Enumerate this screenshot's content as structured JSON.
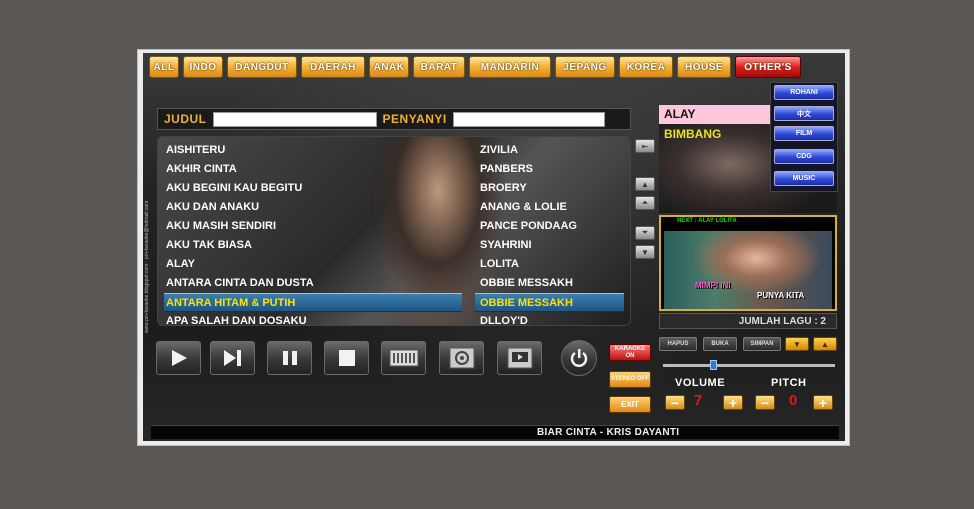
{
  "categories": [
    "ALL",
    "INDO",
    "DANGDUT",
    "DAERAH",
    "ANAK",
    "BARAT",
    "MANDARIN",
    "JEPANG",
    "KOREA",
    "HOUSE",
    "OTHER'S"
  ],
  "search": {
    "judul_label": "JUDUL",
    "penyanyi_label": "PENYANYI",
    "judul_value": "",
    "penyanyi_value": ""
  },
  "songs": [
    {
      "title": "AISHITERU",
      "artist": "ZIVILIA"
    },
    {
      "title": "AKHIR CINTA",
      "artist": "PANBERS"
    },
    {
      "title": "AKU BEGINI KAU BEGITU",
      "artist": "BROERY"
    },
    {
      "title": "AKU DAN ANAKU",
      "artist": "ANANG & LOLIE"
    },
    {
      "title": "AKU MASIH SENDIRI",
      "artist": "PANCE PONDAAG"
    },
    {
      "title": "AKU TAK BIASA",
      "artist": "SYAHRINI"
    },
    {
      "title": "ALAY",
      "artist": "LOLITA"
    },
    {
      "title": "ANTARA CINTA DAN DUSTA",
      "artist": "OBBIE MESSAKH"
    },
    {
      "title": "ANTARA HITAM & PUTIH",
      "artist": "OBBIE MESSAKH"
    },
    {
      "title": "APA SALAH DAN DOSAKU",
      "artist": "DLLOY'D"
    }
  ],
  "selected_index": 8,
  "side_text": "www.pm-karaoke.blogspot.com · pm-karaoke@hotmail.com",
  "now": {
    "title": "ALAY",
    "subtitle": "BIMBANG"
  },
  "others_menu": [
    "ROHANI",
    "中文",
    "FILM",
    "CDG",
    "MUSIC"
  ],
  "video": {
    "next": "NEXT : ALAY  LOLITA",
    "caption_a": "MIMPI INI",
    "caption_b": "PUNYA KITA"
  },
  "jumlah": "JUMLAH LAGU : 2",
  "toggles": {
    "karaoke": "KARAOKE ON",
    "stereo": "STEREO OFF",
    "exit": "EXIT"
  },
  "playlist_buttons": {
    "hapus": "HAPUS",
    "buka": "BUKA",
    "simpan": "SIMPAN"
  },
  "volume": {
    "label": "VOLUME",
    "value": "7"
  },
  "pitch": {
    "label": "PITCH",
    "value": "0"
  },
  "status": "BIAR CINTA - KRIS DAYANTI",
  "colors": {
    "accent": "#f0b02a",
    "selected_row": "#1e5684",
    "selected_text": "#ffe000",
    "value_red": "#e21818"
  },
  "icons": [
    "play-icon",
    "next-icon",
    "pause-icon",
    "stop-icon",
    "keyboard-icon",
    "settings-icon",
    "screen-icon",
    "power-icon",
    "up-icon",
    "down-icon"
  ]
}
